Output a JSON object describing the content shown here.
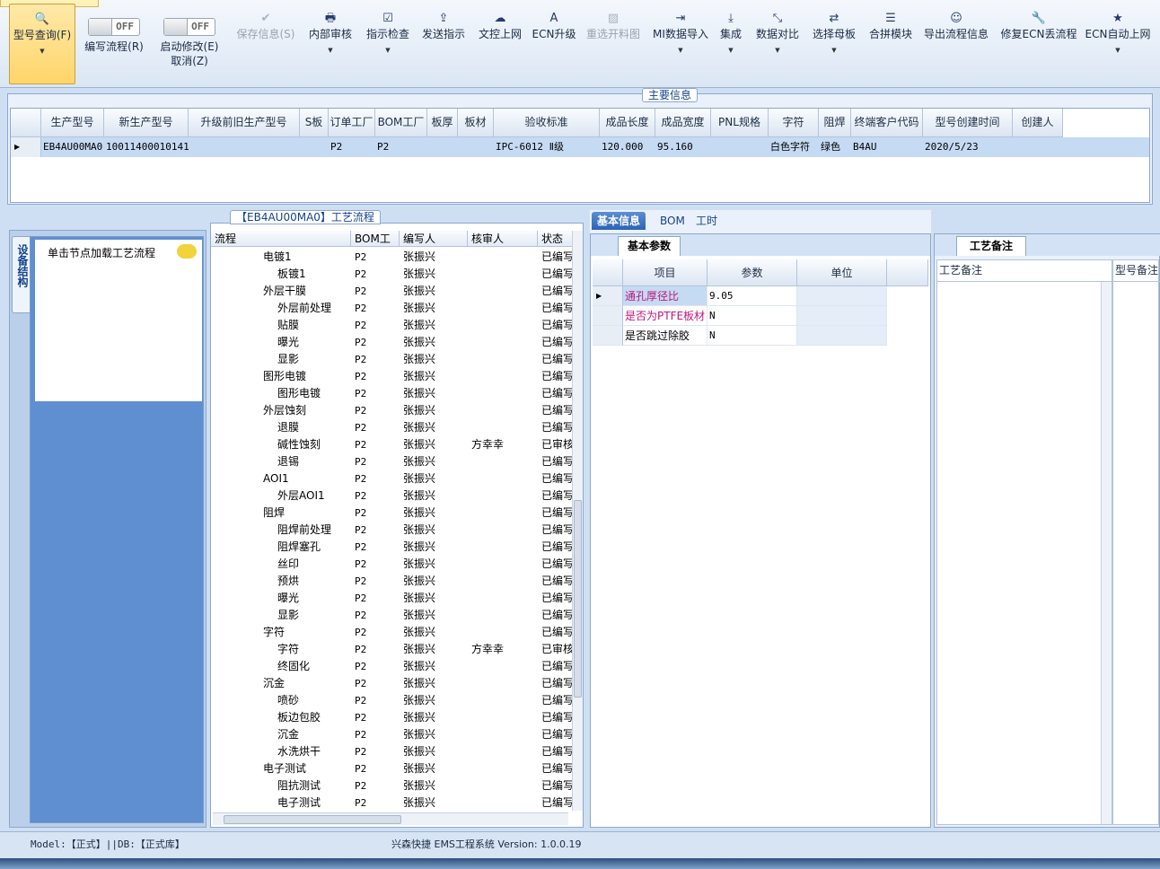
{
  "ribbon": {
    "buttons": [
      {
        "label": "型号查询(F)",
        "icon": "search-icon",
        "enabled": true,
        "dropdown": true,
        "active": true
      },
      {
        "label": "编写流程(R)",
        "icon": "toggle-off",
        "enabled": true,
        "dropdown": false
      },
      {
        "label": "启动修改(E)",
        "icon": "toggle-off",
        "enabled": true,
        "dropdown": false
      },
      {
        "label": "保存信息(S)",
        "icon": "check-icon",
        "enabled": false,
        "dropdown": false
      },
      {
        "label": "内部审核",
        "icon": "printer-icon",
        "enabled": true,
        "dropdown": true
      },
      {
        "label": "指示检查",
        "icon": "checkbox-icon",
        "enabled": true,
        "dropdown": true
      },
      {
        "label": "发送指示",
        "icon": "upload-icon",
        "enabled": true,
        "dropdown": false
      },
      {
        "label": "文控上网",
        "icon": "cloud-upload-icon",
        "enabled": true,
        "dropdown": false
      },
      {
        "label": "ECN升级",
        "icon": "font-icon",
        "enabled": true,
        "dropdown": false
      },
      {
        "label": "重选开料图",
        "icon": "image-icon",
        "enabled": false,
        "dropdown": false
      },
      {
        "label": "MI数据导入",
        "icon": "import-icon",
        "enabled": true,
        "dropdown": true
      },
      {
        "label": "集成",
        "icon": "download-icon",
        "enabled": true,
        "dropdown": true
      },
      {
        "label": "数据对比",
        "icon": "compress-icon",
        "enabled": true,
        "dropdown": true
      },
      {
        "label": "选择母板",
        "icon": "shuffle-icon",
        "enabled": true,
        "dropdown": true
      },
      {
        "label": "合拼模块",
        "icon": "list-icon",
        "enabled": true,
        "dropdown": false
      },
      {
        "label": "导出流程信息",
        "icon": "smile-icon",
        "enabled": true,
        "dropdown": false
      },
      {
        "label": "修复ECN丢流程",
        "icon": "wrench-icon",
        "enabled": true,
        "dropdown": false
      },
      {
        "label": "ECN自动上网",
        "icon": "star-icon",
        "enabled": true,
        "dropdown": true
      }
    ],
    "toggle_off_text": "OFF",
    "cancel_label": "取消(Z)"
  },
  "main_info": {
    "title": "主要信息",
    "columns": [
      "生产型号",
      "新生产型号",
      "升级前旧生产型号",
      "S板",
      "订单工厂",
      "BOM工厂",
      "板厚",
      "板材",
      "验收标准",
      "成品长度",
      "成品宽度",
      "PNL规格",
      "字符",
      "阻焊",
      "终端客户代码",
      "型号创建时间",
      "创建人"
    ],
    "row": [
      "EB4AU00MA0",
      "10011400010141",
      "",
      "",
      "P2",
      "P2",
      "",
      "",
      "IPC-6012 Ⅱ级",
      "120.000",
      "95.160",
      "",
      "白色字符",
      "绿色",
      "B4AU",
      "2020/5/23",
      ""
    ]
  },
  "left_panel": {
    "vertical_tab": "设备结构",
    "hint": "单击节点加载工艺流程"
  },
  "process": {
    "title": "【EB4AU00MA0】工艺流程",
    "columns": [
      "流程",
      "BOM工厂",
      "编写人",
      "核审人",
      "状态"
    ],
    "rows": [
      {
        "lvl": 0,
        "name": "电镀1",
        "bom": "P2",
        "writer": "张振兴",
        "checker": "",
        "status": "已编写"
      },
      {
        "lvl": 1,
        "name": "板镀1",
        "bom": "P2",
        "writer": "张振兴",
        "checker": "",
        "status": "已编写"
      },
      {
        "lvl": 0,
        "name": "外层干膜",
        "bom": "P2",
        "writer": "张振兴",
        "checker": "",
        "status": "已编写"
      },
      {
        "lvl": 1,
        "name": "外层前处理",
        "bom": "P2",
        "writer": "张振兴",
        "checker": "",
        "status": "已编写"
      },
      {
        "lvl": 1,
        "name": "贴膜",
        "bom": "P2",
        "writer": "张振兴",
        "checker": "",
        "status": "已编写"
      },
      {
        "lvl": 1,
        "name": "曝光",
        "bom": "P2",
        "writer": "张振兴",
        "checker": "",
        "status": "已编写"
      },
      {
        "lvl": 1,
        "name": "显影",
        "bom": "P2",
        "writer": "张振兴",
        "checker": "",
        "status": "已编写"
      },
      {
        "lvl": 0,
        "name": "图形电镀",
        "bom": "P2",
        "writer": "张振兴",
        "checker": "",
        "status": "已编写"
      },
      {
        "lvl": 1,
        "name": "图形电镀",
        "bom": "P2",
        "writer": "张振兴",
        "checker": "",
        "status": "已编写"
      },
      {
        "lvl": 0,
        "name": "外层蚀刻",
        "bom": "P2",
        "writer": "张振兴",
        "checker": "",
        "status": "已编写"
      },
      {
        "lvl": 1,
        "name": "退膜",
        "bom": "P2",
        "writer": "张振兴",
        "checker": "",
        "status": "已编写"
      },
      {
        "lvl": 1,
        "name": "碱性蚀刻",
        "bom": "P2",
        "writer": "张振兴",
        "checker": "方幸幸",
        "status": "已审核"
      },
      {
        "lvl": 1,
        "name": "退锡",
        "bom": "P2",
        "writer": "张振兴",
        "checker": "",
        "status": "已编写"
      },
      {
        "lvl": 0,
        "name": "AOI1",
        "bom": "P2",
        "writer": "张振兴",
        "checker": "",
        "status": "已编写"
      },
      {
        "lvl": 1,
        "name": "外层AOI1",
        "bom": "P2",
        "writer": "张振兴",
        "checker": "",
        "status": "已编写"
      },
      {
        "lvl": 0,
        "name": "阻焊",
        "bom": "P2",
        "writer": "张振兴",
        "checker": "",
        "status": "已编写"
      },
      {
        "lvl": 1,
        "name": "阻焊前处理",
        "bom": "P2",
        "writer": "张振兴",
        "checker": "",
        "status": "已编写"
      },
      {
        "lvl": 1,
        "name": "阻焊塞孔",
        "bom": "P2",
        "writer": "张振兴",
        "checker": "",
        "status": "已编写"
      },
      {
        "lvl": 1,
        "name": "丝印",
        "bom": "P2",
        "writer": "张振兴",
        "checker": "",
        "status": "已编写"
      },
      {
        "lvl": 1,
        "name": "预烘",
        "bom": "P2",
        "writer": "张振兴",
        "checker": "",
        "status": "已编写"
      },
      {
        "lvl": 1,
        "name": "曝光",
        "bom": "P2",
        "writer": "张振兴",
        "checker": "",
        "status": "已编写"
      },
      {
        "lvl": 1,
        "name": "显影",
        "bom": "P2",
        "writer": "张振兴",
        "checker": "",
        "status": "已编写"
      },
      {
        "lvl": 0,
        "name": "字符",
        "bom": "P2",
        "writer": "张振兴",
        "checker": "",
        "status": "已编写"
      },
      {
        "lvl": 1,
        "name": "字符",
        "bom": "P2",
        "writer": "张振兴",
        "checker": "方幸幸",
        "status": "已审核"
      },
      {
        "lvl": 1,
        "name": "终固化",
        "bom": "P2",
        "writer": "张振兴",
        "checker": "",
        "status": "已编写"
      },
      {
        "lvl": 0,
        "name": "沉金",
        "bom": "P2",
        "writer": "张振兴",
        "checker": "",
        "status": "已编写"
      },
      {
        "lvl": 1,
        "name": "喷砂",
        "bom": "P2",
        "writer": "张振兴",
        "checker": "",
        "status": "已编写"
      },
      {
        "lvl": 1,
        "name": "板边包胶",
        "bom": "P2",
        "writer": "张振兴",
        "checker": "",
        "status": "已编写"
      },
      {
        "lvl": 1,
        "name": "沉金",
        "bom": "P2",
        "writer": "张振兴",
        "checker": "",
        "status": "已编写"
      },
      {
        "lvl": 1,
        "name": "水洗烘干",
        "bom": "P2",
        "writer": "张振兴",
        "checker": "",
        "status": "已编写"
      },
      {
        "lvl": 0,
        "name": "电子测试",
        "bom": "P2",
        "writer": "张振兴",
        "checker": "",
        "status": "已编写"
      },
      {
        "lvl": 1,
        "name": "阻抗测试",
        "bom": "P2",
        "writer": "张振兴",
        "checker": "",
        "status": "已编写"
      },
      {
        "lvl": 1,
        "name": "电子测试",
        "bom": "P2",
        "writer": "张振兴",
        "checker": "",
        "status": "已编写"
      }
    ]
  },
  "detail": {
    "tabs": [
      "基本信息",
      "BOM",
      "工时"
    ],
    "subtab": "基本参数",
    "columns": [
      "项目",
      "参数",
      "单位"
    ],
    "rows": [
      {
        "item": "通孔厚径比",
        "value": "9.05",
        "unit": "",
        "highlight": true
      },
      {
        "item": "是否为PTFE板材",
        "value": "N",
        "unit": "",
        "highlight": true
      },
      {
        "item": "是否跳过除胶",
        "value": "N",
        "unit": "",
        "highlight": false
      }
    ]
  },
  "remarks": {
    "tab": "工艺备注",
    "columns": [
      "工艺备注",
      "型号备注"
    ]
  },
  "status_bar": {
    "left": "Model:【正式】||DB:【正式库】",
    "center": "兴森快捷 EMS工程系统 Version: 1.0.0.19"
  }
}
